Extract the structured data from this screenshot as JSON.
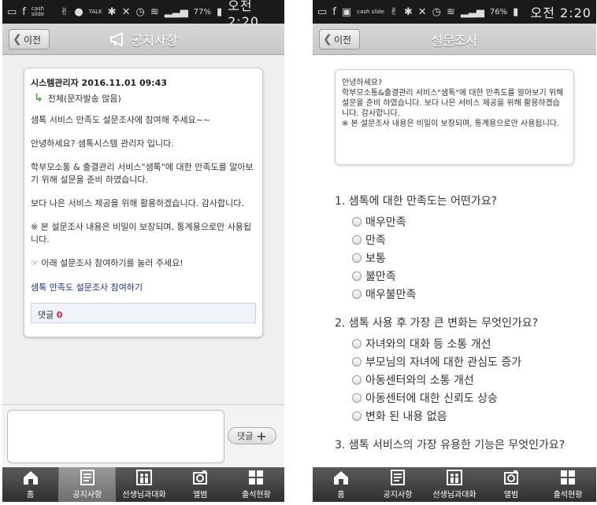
{
  "left": {
    "status": {
      "icons": [
        "msg-icon",
        "facebook-icon",
        "cashslide-icon",
        "victory-icon",
        "chat-icon",
        "talk-icon",
        "bluetooth-icon",
        "mute-icon",
        "alarm-icon",
        "wifi-icon",
        "signal-icon"
      ],
      "cashslide": "cash slide",
      "talk": "TALK",
      "battery": "77%",
      "time": "오전 2:20"
    },
    "header": {
      "back": "이전",
      "title": "공지사항"
    },
    "post": {
      "author_line": "시스템관리자 2016.11.01 09:43",
      "target": "전체(문자발송 않음)",
      "paragraphs": [
        "샘톡 서비스 만족도 설문조사에 참여해 주세요~~",
        "안녕하세요? 샘톡시스템 관리자 입니다.",
        "학부모소통 & 출결관리 서비스\"샘톡\"에 대한 만족도를 알아보기 위해 설문을 준비 하였습니다.",
        "보다 나은 서비스 제공을 위해 활용하겠습니다. 감사합니다.",
        "※ 본 설문조사 내용은 비밀이 보장되며, 통계용으로만 사용됩니다.",
        "☞ 아래 설문조사 참여하기를 눌러 주세요!"
      ],
      "link": "샘톡 만족도 설문조사 참여하기",
      "comment_label": "댓글",
      "comment_count": "0"
    },
    "reply_button": "댓글"
  },
  "right": {
    "status": {
      "battery": "76%",
      "time": "오전 2:20"
    },
    "header": {
      "back": "이전",
      "title": "설문조사"
    },
    "info": [
      "안녕하세요?",
      "학부모소통&출결관리 서비스\"샘톡\"에 대한 만족도를 알아보기 위해 설문을 준비 하였습니다. 보다 나은 서비스 제공을 위해 활용하겠습니다. 감사합니다.",
      "※ 본 설문조사 내용은 비밀이 보장되며, 통계용으로만 사용됩니다."
    ],
    "questions": [
      {
        "title": "1. 샘톡에 대한 만족도는 어떤가요?",
        "options": [
          "매우만족",
          "만족",
          "보통",
          "불만족",
          "매우불만족"
        ]
      },
      {
        "title": "2. 샘톡 사용 후 가장 큰 변화는 무엇인가요?",
        "options": [
          "자녀와의 대화 등 소통 개선",
          "부모님의 자녀에 대한 관심도 증가",
          "아동센터와의 소통 개선",
          "아동센터에 대한 신뢰도 상승",
          "변화 된 내용 없음"
        ]
      },
      {
        "title": "3. 샘톡 서비스의 가장 유용한 기능은 무엇인가요?",
        "options": []
      }
    ]
  },
  "tabs": [
    "홈",
    "공지사항",
    "선생님과대화",
    "앨범",
    "출석현황"
  ]
}
